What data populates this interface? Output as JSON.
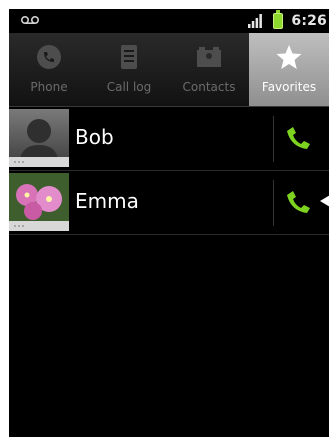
{
  "statusbar": {
    "time": "6:26"
  },
  "tabs": [
    {
      "label": "Phone",
      "icon": "phone-icon"
    },
    {
      "label": "Call log",
      "icon": "call-log-icon"
    },
    {
      "label": "Contacts",
      "icon": "contacts-icon"
    },
    {
      "label": "Favorites",
      "icon": "star-icon",
      "active": true
    }
  ],
  "favorites": [
    {
      "name": "Bob"
    },
    {
      "name": "Emma"
    }
  ],
  "colors": {
    "call_green": "#7ed321",
    "active_tab": "#a8a8a8",
    "background": "#000000"
  }
}
